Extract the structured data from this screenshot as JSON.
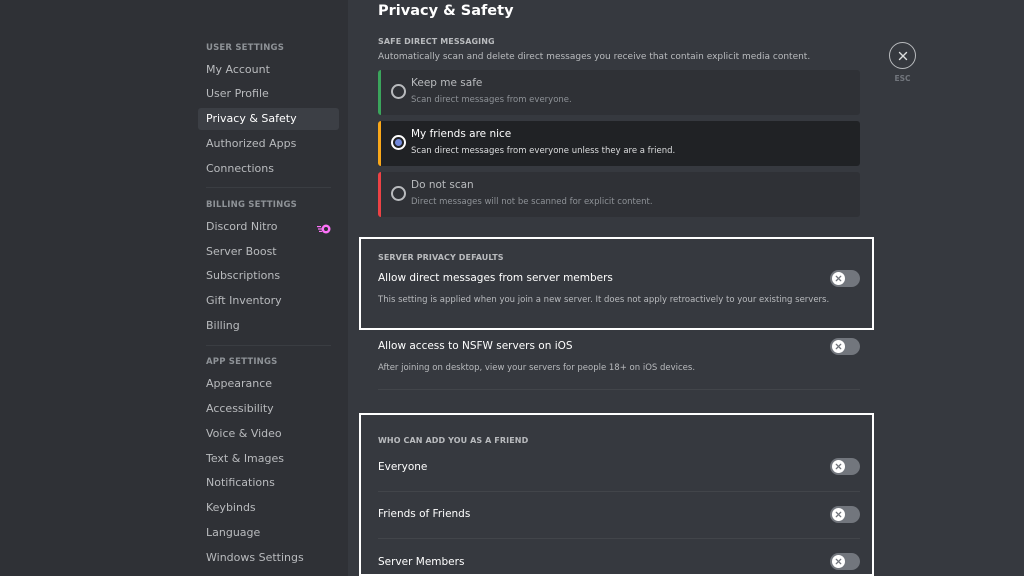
{
  "sidebar": {
    "sections": [
      {
        "header": "User Settings",
        "items": [
          {
            "label": "My Account"
          },
          {
            "label": "User Profile"
          },
          {
            "label": "Privacy & Safety",
            "active": true
          },
          {
            "label": "Authorized Apps"
          },
          {
            "label": "Connections"
          }
        ]
      },
      {
        "header": "Billing Settings",
        "items": [
          {
            "label": "Discord Nitro",
            "icon": "nitro-icon"
          },
          {
            "label": "Server Boost"
          },
          {
            "label": "Subscriptions"
          },
          {
            "label": "Gift Inventory"
          },
          {
            "label": "Billing"
          }
        ]
      },
      {
        "header": "App Settings",
        "items": [
          {
            "label": "Appearance"
          },
          {
            "label": "Accessibility"
          },
          {
            "label": "Voice & Video"
          },
          {
            "label": "Text & Images"
          },
          {
            "label": "Notifications"
          },
          {
            "label": "Keybinds"
          },
          {
            "label": "Language"
          },
          {
            "label": "Windows Settings"
          }
        ]
      }
    ]
  },
  "page": {
    "title": "Privacy & Safety",
    "close_label": "ESC"
  },
  "safe_dm": {
    "header": "Safe Direct Messaging",
    "description": "Automatically scan and delete direct messages you receive that contain explicit media content.",
    "options": [
      {
        "title": "Keep me safe",
        "description": "Scan direct messages from everyone.",
        "selected": false,
        "accent": "#3ba55c"
      },
      {
        "title": "My friends are nice",
        "description": "Scan direct messages from everyone unless they are a friend.",
        "selected": true,
        "accent": "#faa81a"
      },
      {
        "title": "Do not scan",
        "description": "Direct messages will not be scanned for explicit content.",
        "selected": false,
        "accent": "#ed4245"
      }
    ]
  },
  "server_privacy": {
    "header": "Server Privacy Defaults",
    "settings": [
      {
        "title": "Allow direct messages from server members",
        "description": "This setting is applied when you join a new server. It does not apply retroactively to your existing servers.",
        "enabled": false
      },
      {
        "title": "Allow access to NSFW servers on iOS",
        "description": "After joining on desktop, view your servers for people 18+ on iOS devices.",
        "enabled": false
      }
    ]
  },
  "friend_requests": {
    "header": "Who can add you as a friend",
    "settings": [
      {
        "title": "Everyone",
        "enabled": false
      },
      {
        "title": "Friends of Friends",
        "enabled": false
      },
      {
        "title": "Server Members",
        "enabled": false
      }
    ]
  },
  "colors": {
    "sidebar_bg": "#2f3136",
    "main_bg": "#36393f",
    "radio_selected": "#7289da",
    "nitro": "#ff73fa",
    "toggle_off": "#72767d"
  }
}
